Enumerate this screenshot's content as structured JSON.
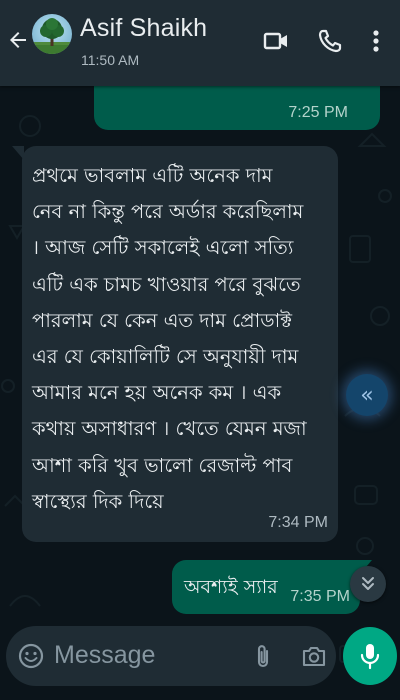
{
  "header": {
    "contact_name": "Asif Shaikh",
    "last_seen": "11:50 AM",
    "icons": [
      "back-arrow-icon",
      "video-call-icon",
      "voice-call-icon",
      "more-options-icon"
    ]
  },
  "messages": [
    {
      "direction": "outgoing",
      "text": "",
      "time": "7:25 PM"
    },
    {
      "direction": "incoming",
      "text": "প্রথমে ভাবলাম এটি অনেক দাম\nনেব না কিন্তু পরে অর্ডার করেছিলাম\n। আজ সেটি সকালেই এলো সত্যি\nএটি এক চামচ খাওয়ার পরে বুঝতে\nপারলাম যে কেন এত দাম প্রোডাক্ট\nএর যে কোয়ালিটি সে অনুযায়ী দাম\nআমার মনে হয় অনেক কম । এক\nকথায় অসাধারণ । খেতে যেমন মজা\nআশা করি খুব ভালো রেজাল্ট পাব\nস্বাস্থ্যের দিক দিয়ে",
      "time": "7:34 PM"
    },
    {
      "direction": "outgoing",
      "text": "অবশ্যই স্যার",
      "time": "7:35 PM"
    }
  ],
  "floating": {
    "rewind_glyph": "«"
  },
  "composer": {
    "placeholder": "Message"
  },
  "colors": {
    "header_bg": "#1f2c34",
    "chat_bg": "#0b141a",
    "incoming_bubble": "#1f2c34",
    "outgoing_bubble": "#005c4b",
    "accent": "#00a884"
  }
}
